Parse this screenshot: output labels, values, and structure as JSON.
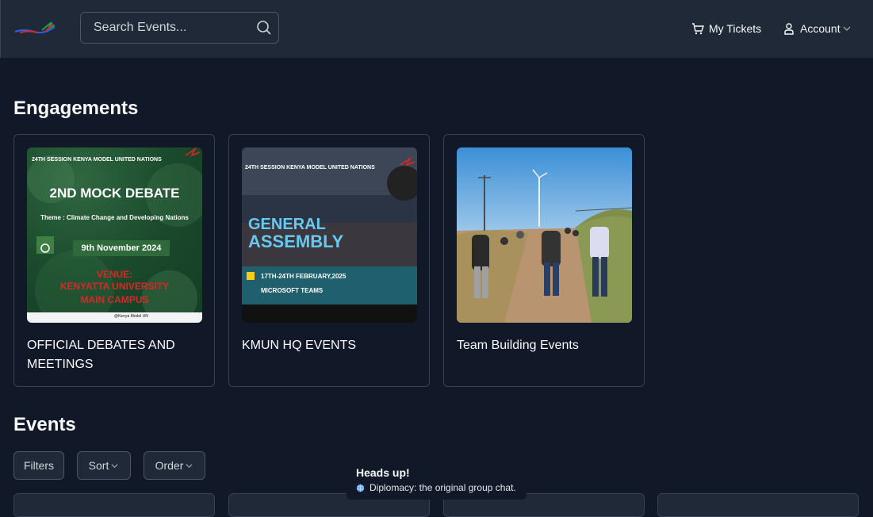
{
  "header": {
    "search_placeholder": "Search Events...",
    "my_tickets_label": "My Tickets",
    "account_label": "Account"
  },
  "engagements": {
    "title": "Engagements",
    "cards": [
      {
        "title": "OFFICIAL DEBATES AND MEETINGS",
        "image_text": {
          "session": "24TH SESSION KENYA MODEL UNITED NATIONS",
          "headline": "2ND MOCK DEBATE",
          "theme": "Theme : Climate Change and Developing Nations",
          "date": "9th November 2024",
          "venue_label": "VENUE:",
          "venue": "KENYATTA UNIVERSITY",
          "venue2": "MAIN CAMPUS",
          "handle": "@Kenya Model UN"
        }
      },
      {
        "title": "KMUN HQ EVENTS",
        "image_text": {
          "session": "24TH SESSION KENYA MODEL UNITED NATIONS",
          "headline1": "GENERAL",
          "headline2": "ASSEMBLY",
          "dates": "17TH-24TH FEBRUARY,2025",
          "platform": "MICROSOFT TEAMS"
        }
      },
      {
        "title": "Team Building Events"
      }
    ]
  },
  "events": {
    "title": "Events",
    "filters_label": "Filters",
    "sort_label": "Sort",
    "order_label": "Order"
  },
  "toast": {
    "title": "Heads up!",
    "message": "Diplomacy: the original group chat."
  },
  "colors": {
    "background": "#111827",
    "header": "#1f2937",
    "border": "#374151"
  }
}
